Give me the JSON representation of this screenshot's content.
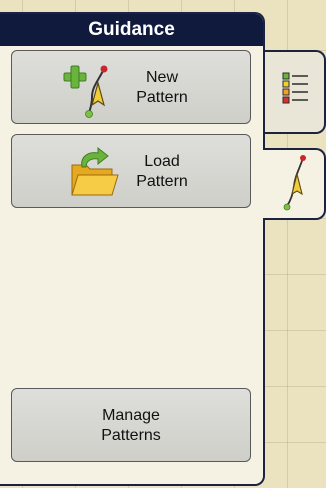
{
  "panel": {
    "title": "Guidance"
  },
  "buttons": {
    "new_pattern": "New\nPattern",
    "load_pattern": "Load\nPattern",
    "manage_patterns": "Manage\nPatterns"
  },
  "tabs": {
    "list_tab_icon": "list-icon",
    "guidance_tab_icon": "guidance-line-icon"
  },
  "colors": {
    "header_bg": "#101a3d",
    "panel_bg": "#f5f2e3",
    "button_bg": "#d6d6d2",
    "map_bg": "#ebe3c0"
  }
}
